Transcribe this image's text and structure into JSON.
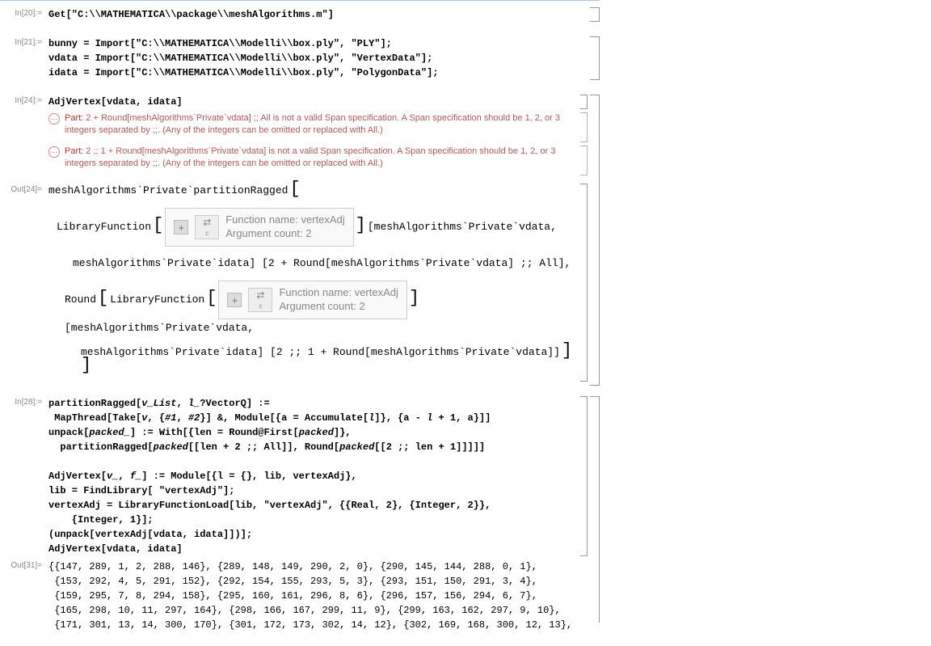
{
  "cells": {
    "in20": {
      "label": "In[20]:=",
      "line1": "Get[\"C:\\\\MATHEMATICA\\\\package\\\\meshAlgorithms.m\"]"
    },
    "in21": {
      "label": "In[21]:=",
      "line1": "bunny = Import[\"C:\\\\MATHEMATICA\\\\Modelli\\\\box.ply\", \"PLY\"];",
      "line2": "vdata = Import[\"C:\\\\MATHEMATICA\\\\Modelli\\\\box.ply\", \"VertexData\"];",
      "line3": "idata = Import[\"C:\\\\MATHEMATICA\\\\Modelli\\\\box.ply\", \"PolygonData\"];"
    },
    "in24": {
      "label": "In[24]:=",
      "line1": "AdjVertex[vdata, idata]"
    },
    "msg1": {
      "tag": "Part:",
      "text": " 2 + Round[meshAlgorithms`Private`vdata] ;; All is not a valid Span specification. A Span specification should be 1, 2, or 3 integers separated by ;;. (Any of the integers can be omitted or replaced with All.)"
    },
    "msg2": {
      "tag": "Part:",
      "text": " 2 ;; 1 + Round[meshAlgorithms`Private`vdata] is not a valid Span specification. A Span specification should be 1, 2, or 3 integers separated by ;;. (Any of the integers can be omitted or replaced with All.)"
    },
    "out24": {
      "label": "Out[24]=",
      "pre": "meshAlgorithms`Private`partitionRagged",
      "libfn_pre": "LibraryFunction",
      "fn_name": "Function name: vertexAdj",
      "arg_count": "Argument count: 2",
      "post1": "[meshAlgorithms`Private`vdata,",
      "line2": "meshAlgorithms`Private`idata] [2 + Round[meshAlgorithms`Private`vdata] ;; All],",
      "round_pre": "Round",
      "post2": "[meshAlgorithms`Private`vdata,",
      "line4": "meshAlgorithms`Private`idata] [2 ;; 1 + Round[meshAlgorithms`Private`vdata]]"
    },
    "in28": {
      "label": "In[28]:=",
      "l1a": "partitionRagged[",
      "l1b": "v_List",
      "l1c": ", ",
      "l1d": "l_",
      "l1e": "?VectorQ] :=",
      "l2a": " MapThread[Take[",
      "l2b": "v",
      "l2c": ", {",
      "l2d": "#1",
      "l2e": ", ",
      "l2f": "#2",
      "l2g": "}] &, Module[{a = Accumulate[",
      "l2h": "l",
      "l2i": "]}, {a - ",
      "l2j": "l",
      "l2k": " + 1, a}]]",
      "l3a": "unpack[",
      "l3b": "packed_",
      "l3c": "] := With[{len = Round@First[",
      "l3d": "packed",
      "l3e": "]},",
      "l4a": "  partitionRagged[",
      "l4b": "packed",
      "l4c": "[[len + 2 ;; All]], Round[",
      "l4d": "packed",
      "l4e": "[[2 ;; len + 1]]]]]",
      "l5": " ",
      "l6a": "AdjVertex[",
      "l6b": "v_",
      "l6c": ", ",
      "l6d": "f_",
      "l6e": "] := Module[{l = {}, lib, vertexAdj},",
      "l7": "lib = FindLibrary[ \"vertexAdj\"];",
      "l8": "vertexAdj = LibraryFunctionLoad[lib, \"vertexAdj\", {{Real, 2}, {Integer, 2}},",
      "l9": "    {Integer, 1}];",
      "l10": "(unpack[vertexAdj[vdata, idata]])];",
      "l11": "AdjVertex[vdata, idata]"
    },
    "out31": {
      "label": "Out[31]=",
      "l1": "{{147, 289, 1, 2, 288, 146}, {289, 148, 149, 290, 2, 0}, {290, 145, 144, 288, 0, 1},",
      "l2": " {153, 292, 4, 5, 291, 152}, {292, 154, 155, 293, 5, 3}, {293, 151, 150, 291, 3, 4},",
      "l3": " {159, 295, 7, 8, 294, 158}, {295, 160, 161, 296, 8, 6}, {296, 157, 156, 294, 6, 7},",
      "l4": " {165, 298, 10, 11, 297, 164}, {298, 166, 167, 299, 11, 9}, {299, 163, 162, 297, 9, 10},",
      "l5": " {171, 301, 13, 14, 300, 170}, {301, 172, 173, 302, 14, 12}, {302, 169, 168, 300, 12, 13},"
    }
  },
  "icons": {
    "ellipsis": "⋯",
    "plus": "+",
    "arrows": "⇄",
    "c": "c"
  },
  "brackets": {
    "lb": "[",
    "rb": "]"
  }
}
